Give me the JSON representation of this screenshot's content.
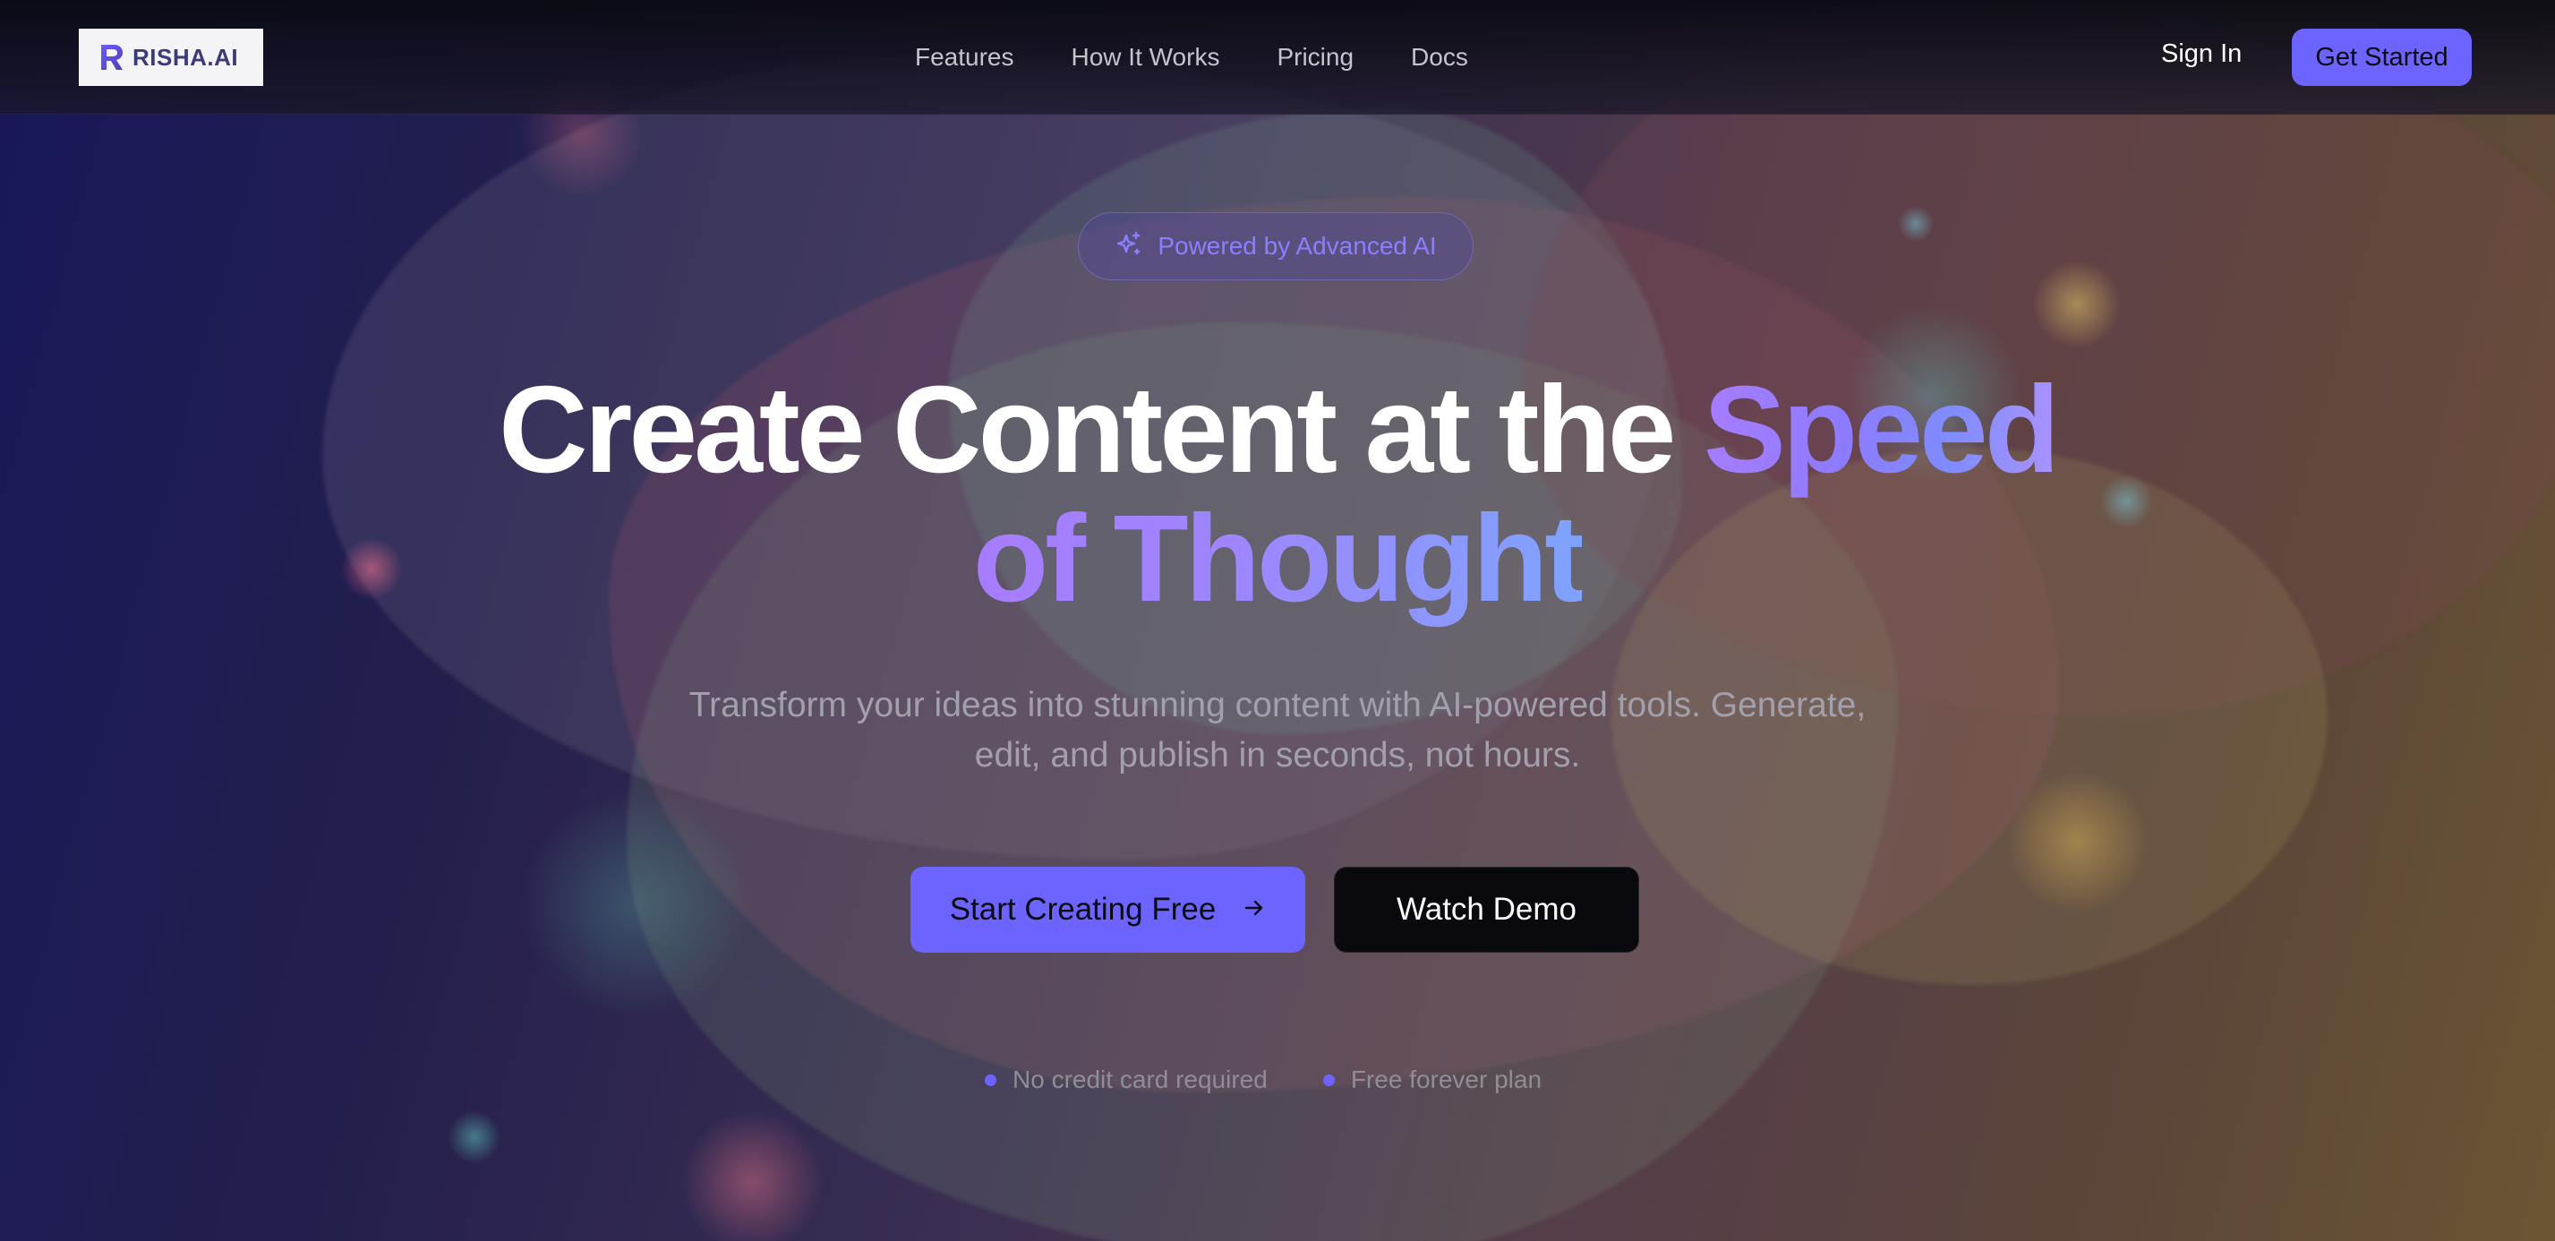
{
  "brand": {
    "logo_text": "RISHA.AI",
    "accent": "#6d63ff"
  },
  "nav": {
    "links": [
      "Features",
      "How It Works",
      "Pricing",
      "Docs"
    ],
    "sign_in": "Sign In",
    "get_started": "Get Started"
  },
  "hero": {
    "badge": {
      "icon": "sparkles-icon",
      "text": "Powered by Advanced AI"
    },
    "headline_line1_plain": "Create Content at the ",
    "headline_line1_accent": "Speed",
    "headline_line2_accent": "of Thought",
    "subtitle_line1": "Transform your ideas into stunning content with AI-powered tools. Generate,",
    "subtitle_line2": "edit, and publish in seconds, not hours.",
    "primary_cta": {
      "label": "Start Creating Free",
      "icon": "arrow-right-icon"
    },
    "secondary_cta": {
      "label": "Watch Demo"
    },
    "perks": [
      "No credit card required",
      "Free forever plan"
    ]
  }
}
